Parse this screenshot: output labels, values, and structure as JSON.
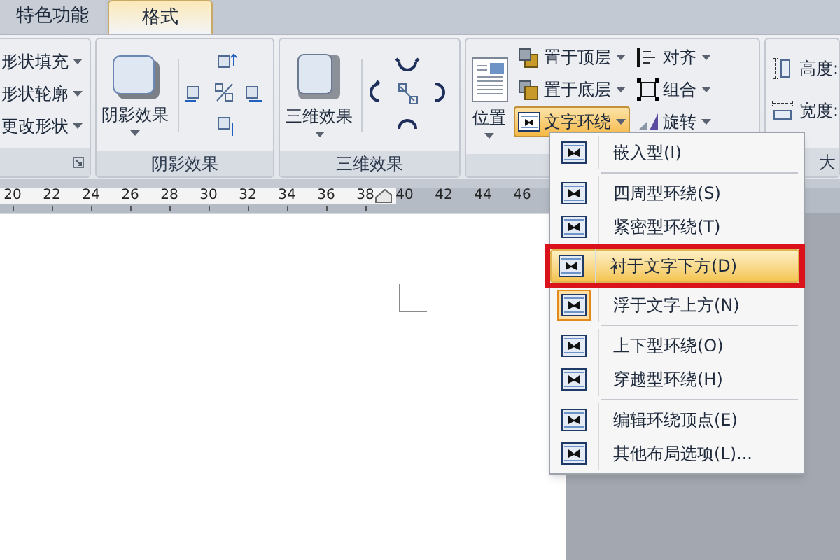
{
  "tabs": [
    {
      "label": "特色功能",
      "selected": false
    },
    {
      "label": "格式",
      "selected": true
    }
  ],
  "ribbon": {
    "shape_group": {
      "buttons": [
        "形状填充",
        "形状轮廓",
        "更改形状"
      ]
    },
    "shadow_group": {
      "button": "阴影效果",
      "label": "阴影效果"
    },
    "threed_group": {
      "button": "三维效果",
      "label": "三维效果"
    },
    "arrange_group": {
      "position_button": "位置",
      "buttons": [
        {
          "label": "置于顶层",
          "active": false
        },
        {
          "label": "置于底层",
          "active": false
        },
        {
          "label": "文字环绕",
          "active": true
        }
      ],
      "side_buttons": [
        "对齐",
        "组合",
        "旋转"
      ]
    },
    "size_group": {
      "fields": [
        "高度:",
        "宽度:"
      ],
      "label": "大"
    }
  },
  "ruler": {
    "ticks": [
      "20",
      "22",
      "24",
      "26",
      "28",
      "30",
      "32",
      "34",
      "36",
      "38",
      "40",
      "42",
      "44",
      "46"
    ]
  },
  "wrap_menu": {
    "items": [
      {
        "kind": "item",
        "label": "嵌入型(I)",
        "selected": false,
        "checked": false,
        "outlined": false
      },
      {
        "kind": "separator"
      },
      {
        "kind": "item",
        "label": "四周型环绕(S)",
        "selected": false,
        "checked": false,
        "outlined": false
      },
      {
        "kind": "item",
        "label": "紧密型环绕(T)",
        "selected": false,
        "checked": false,
        "outlined": false
      },
      {
        "kind": "item",
        "label": "衬于文字下方(D)",
        "selected": true,
        "checked": false,
        "outlined": true
      },
      {
        "kind": "item",
        "label": "浮于文字上方(N)",
        "selected": false,
        "checked": true,
        "outlined": false
      },
      {
        "kind": "separator"
      },
      {
        "kind": "item",
        "label": "上下型环绕(O)",
        "selected": false,
        "checked": false,
        "outlined": false
      },
      {
        "kind": "item",
        "label": "穿越型环绕(H)",
        "selected": false,
        "checked": false,
        "outlined": false
      },
      {
        "kind": "separator"
      },
      {
        "kind": "item",
        "label": "编辑环绕顶点(E)",
        "selected": false,
        "checked": false,
        "outlined": false
      },
      {
        "kind": "item",
        "label": "其他布局选项(L)...",
        "selected": false,
        "checked": false,
        "outlined": false
      }
    ]
  }
}
